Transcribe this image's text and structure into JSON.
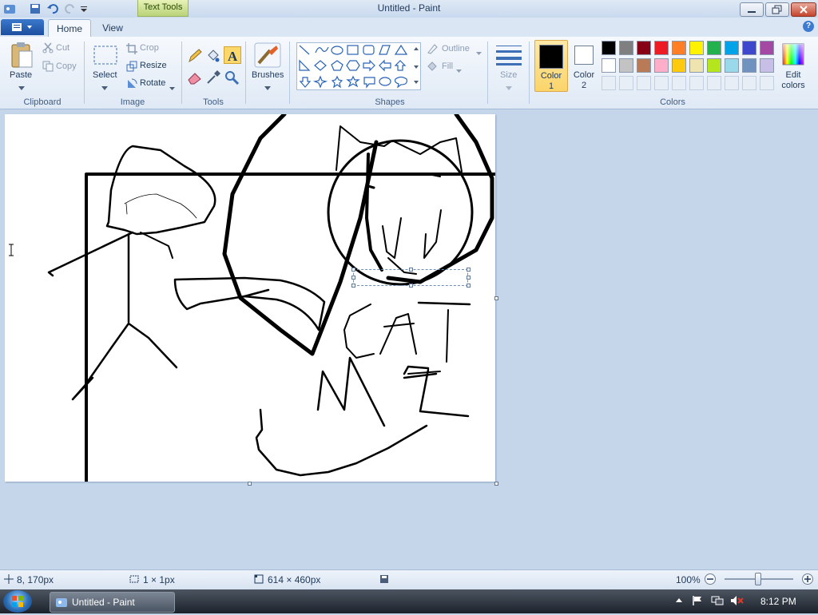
{
  "window": {
    "title": "Untitled - Paint",
    "context_tab": "Text Tools"
  },
  "ribbon_tabs": [
    {
      "label": "Home",
      "active": true
    },
    {
      "label": "View",
      "active": false
    }
  ],
  "clipboard": {
    "group_label": "Clipboard",
    "paste": "Paste",
    "cut": "Cut",
    "copy": "Copy"
  },
  "image": {
    "group_label": "Image",
    "select": "Select",
    "crop": "Crop",
    "resize": "Resize",
    "rotate": "Rotate"
  },
  "tools": {
    "group_label": "Tools"
  },
  "brushes": {
    "label": "Brushes"
  },
  "shapes": {
    "group_label": "Shapes",
    "outline": "Outline",
    "fill": "Fill"
  },
  "size": {
    "label": "Size"
  },
  "colors": {
    "group_label": "Colors",
    "color1_line1": "Color",
    "color1_line2": "1",
    "color2_line1": "Color",
    "color2_line2": "2",
    "edit_line1": "Edit",
    "edit_line2": "colors",
    "color1_value": "#000000",
    "color2_value": "#ffffff",
    "palette_row1": [
      "#000000",
      "#7f7f7f",
      "#880015",
      "#ed1c24",
      "#ff7f27",
      "#fff200",
      "#22b14c",
      "#00a2e8",
      "#3f48cc",
      "#a349a4"
    ],
    "palette_row2": [
      "#ffffff",
      "#c3c3c3",
      "#b97a57",
      "#ffaec9",
      "#ffc90e",
      "#efe4b0",
      "#b5e61d",
      "#99d9ea",
      "#7092be",
      "#c8bfe7"
    ]
  },
  "status": {
    "cursor_pos": "8, 170px",
    "selection_size": "1 × 1px",
    "image_size": "614 × 460px",
    "zoom": "100%"
  },
  "taskbar": {
    "task_title": "Untitled - Paint",
    "clock": "8:12 PM"
  }
}
